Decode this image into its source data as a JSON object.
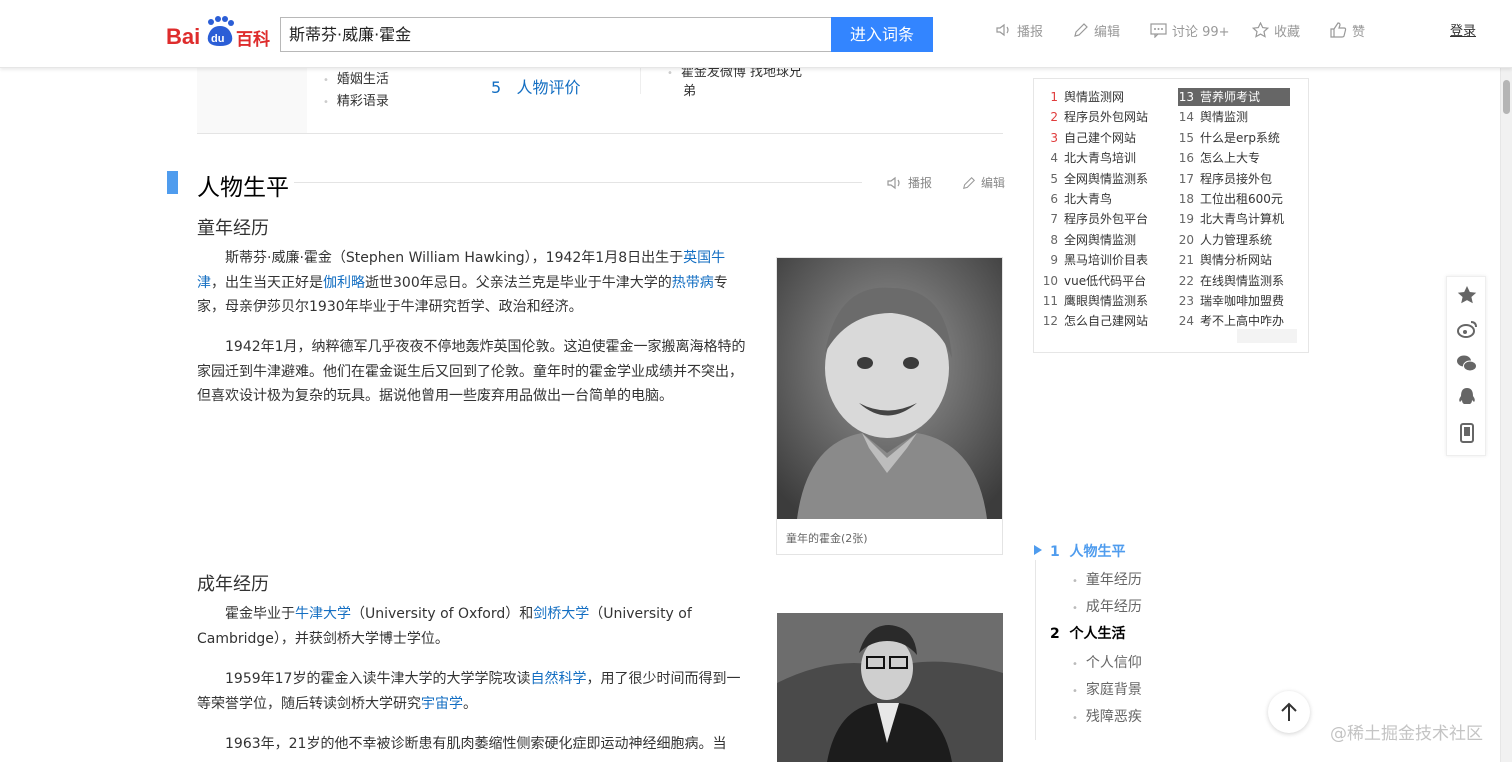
{
  "header": {
    "search_value": "斯蒂芬·威廉·霍金",
    "search_button": "进入词条",
    "tools": [
      {
        "label": "播报",
        "icon": "speaker-icon"
      },
      {
        "label": "编辑",
        "icon": "pencil-icon"
      },
      {
        "label": "讨论 99+",
        "icon": "chat-icon"
      },
      {
        "label": "收藏",
        "icon": "star-icon"
      },
      {
        "label": "赞",
        "icon": "thumb-up-icon"
      }
    ],
    "login": "登录"
  },
  "toc_top": {
    "bullets": [
      "婚姻生活",
      "精彩语录"
    ],
    "item5": {
      "num": "5",
      "label": "人物评价"
    },
    "right_text_line1": "霍金发微博 找地球兄",
    "right_text_line2": "弟"
  },
  "section": {
    "title": "人物生平",
    "tool_play": "播报",
    "tool_edit": "编辑"
  },
  "childhood": {
    "title": "童年经历",
    "p1_a": "斯蒂芬·威廉·霍金（Stephen William Hawking），1942年1月8日出生于",
    "p1_link1": "英国牛津",
    "p1_b": "，出生当天正好是",
    "p1_link2": "伽利略",
    "p1_c": "逝世300年忌日。父亲法兰克是毕业于牛津大学的",
    "p1_link3": "热带病",
    "p1_d": "专家，母亲伊莎贝尔1930年毕业于牛津研究哲学、政治和经济。",
    "p2": "1942年1月，纳粹德军几乎夜夜不停地轰炸英国伦敦。这迫使霍金一家搬离海格特的家园迁到牛津避难。他们在霍金诞生后又回到了伦敦。童年时的霍金学业成绩并不突出，但喜欢设计极为复杂的玩具。据说他曾用一些废弃用品做出一台简单的电脑。",
    "photo_caption": "童年的霍金(2张)"
  },
  "adulthood": {
    "title": "成年经历",
    "p1_a": "霍金毕业于",
    "p1_link1": "牛津大学",
    "p1_b": "（University of Oxford）和",
    "p1_link2": "剑桥大学",
    "p1_c": "（University of Cambridge），并获剑桥大学博士学位。",
    "p2_a": "1959年17岁的霍金入读牛津大学的大学学院攻读",
    "p2_link1": "自然科学",
    "p2_b": "，用了很少时间而得到一等荣誉学位，随后转读剑桥大学研究",
    "p2_link2": "宇宙学",
    "p2_c": "。",
    "p3": "1963年，21岁的他不幸被诊断患有肌肉萎缩性侧索硬化症即运动神经细胞病。当"
  },
  "hot_list": {
    "left": [
      {
        "n": "1",
        "t": "舆情监测网"
      },
      {
        "n": "2",
        "t": "程序员外包网站"
      },
      {
        "n": "3",
        "t": "自己建个网站"
      },
      {
        "n": "4",
        "t": "北大青鸟培训"
      },
      {
        "n": "5",
        "t": "全网舆情监测系"
      },
      {
        "n": "6",
        "t": "北大青鸟"
      },
      {
        "n": "7",
        "t": "程序员外包平台"
      },
      {
        "n": "8",
        "t": "全网舆情监测"
      },
      {
        "n": "9",
        "t": "黑马培训价目表"
      },
      {
        "n": "10",
        "t": "vue低代码平台"
      },
      {
        "n": "11",
        "t": "鹰眼舆情监测系"
      },
      {
        "n": "12",
        "t": "怎么自己建网站"
      }
    ],
    "right": [
      {
        "n": "13",
        "t": "营养师考试"
      },
      {
        "n": "14",
        "t": "舆情监测"
      },
      {
        "n": "15",
        "t": "什么是erp系统"
      },
      {
        "n": "16",
        "t": "怎么上大专"
      },
      {
        "n": "17",
        "t": "程序员接外包"
      },
      {
        "n": "18",
        "t": "工位出租600元"
      },
      {
        "n": "19",
        "t": "北大青鸟计算机"
      },
      {
        "n": "20",
        "t": "人力管理系统"
      },
      {
        "n": "21",
        "t": "舆情分析网站"
      },
      {
        "n": "22",
        "t": "在线舆情监测系"
      },
      {
        "n": "23",
        "t": "瑞幸咖啡加盟费"
      },
      {
        "n": "24",
        "t": "考不上高中咋办"
      }
    ]
  },
  "catalog": {
    "h1": {
      "num": "1",
      "label": "人物生平"
    },
    "h1_subs": [
      "童年经历",
      "成年经历"
    ],
    "h2": {
      "num": "2",
      "label": "个人生活"
    },
    "h2_subs": [
      "个人信仰",
      "家庭背景",
      "残障恶疾"
    ]
  },
  "watermark": "@稀土掘金技术社区",
  "colors": {
    "accent": "#3385ff",
    "link": "#136ec2",
    "section_bar": "#4f9cee",
    "hot_red": "#e03c3c"
  }
}
